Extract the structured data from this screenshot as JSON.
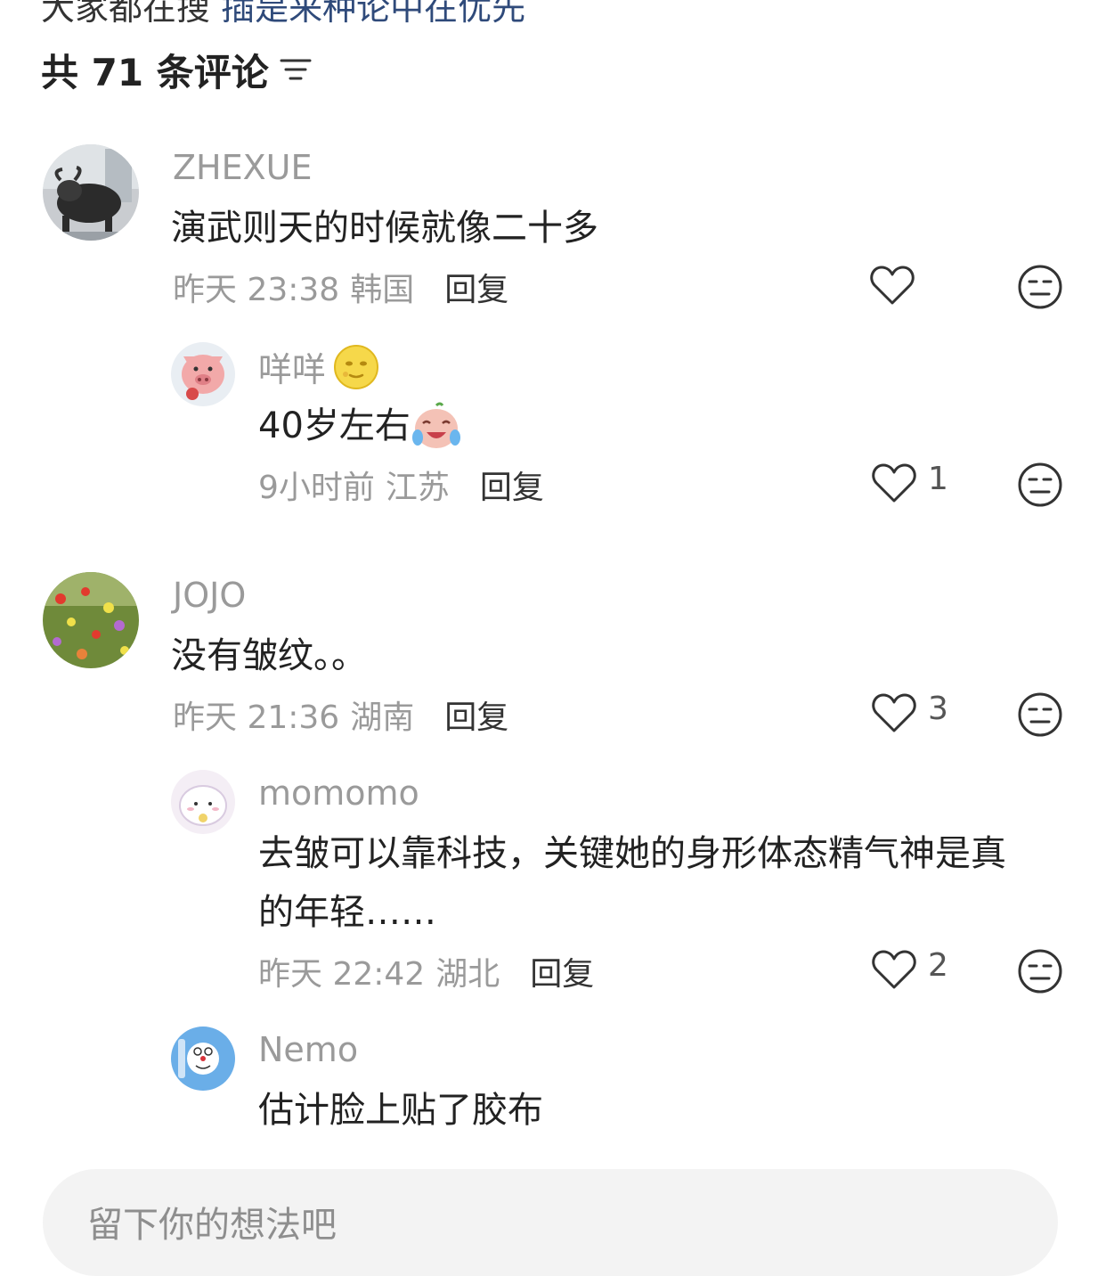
{
  "top_partial": {
    "text": "大家都在搜",
    "link": "插是来种论中在优先"
  },
  "header": {
    "title": "共 71 条评论"
  },
  "comments": [
    {
      "username": "ZHEXUE",
      "text": "演武则天的时候就像二十多",
      "time": "昨天 23:38",
      "location": "韩国",
      "reply_label": "回复",
      "likes": ""
    },
    {
      "username": "咩咩",
      "username_emoji": "moon-face-emoji",
      "text": "40岁左右",
      "text_emoji": "crying-laugh-sticker",
      "time": "9小时前",
      "location": "江苏",
      "reply_label": "回复",
      "likes": "1"
    },
    {
      "username": "JOJO",
      "text": "没有皱纹。。",
      "time": "昨天 21:36",
      "location": "湖南",
      "reply_label": "回复",
      "likes": "3"
    },
    {
      "username": "momomo",
      "text_line1": "去皱可以靠科技，关键她的身形体态精气神是真",
      "text_line2": "的年轻……",
      "time": "昨天 22:42",
      "location": "湖北",
      "reply_label": "回复",
      "likes": "2"
    },
    {
      "username": "Nemo",
      "text": "估计脸上贴了胶布"
    }
  ],
  "input": {
    "placeholder": "留下你的想法吧"
  },
  "icons": {
    "sort": "sort-filter-icon",
    "like": "heart-outline-icon",
    "dislike": "neutral-face-icon"
  }
}
